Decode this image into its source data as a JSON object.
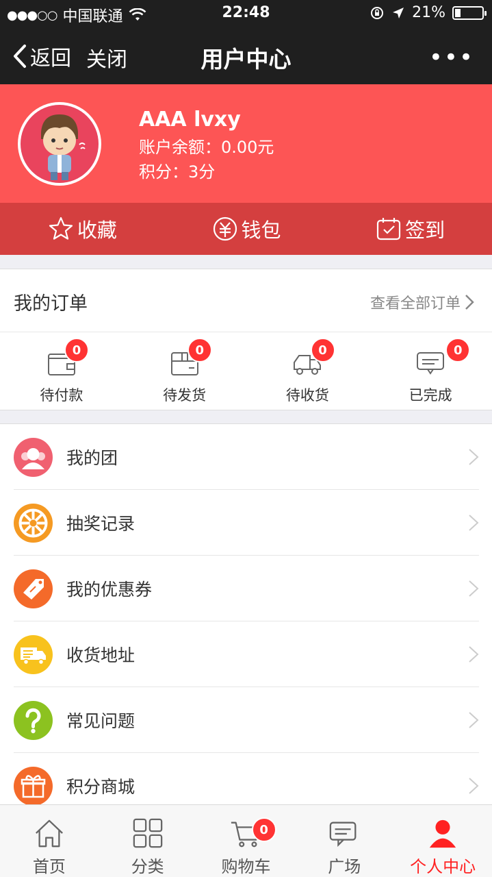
{
  "status_bar": {
    "signal": "●●●○○",
    "carrier": "中国联通",
    "time": "22:48",
    "battery": "21%"
  },
  "nav": {
    "back_label": "返回",
    "close_label": "关闭",
    "title": "用户中心",
    "more": "•••"
  },
  "profile": {
    "name": "AAA lvxy",
    "balance": "账户余额：0.00元",
    "points": "积分：3分"
  },
  "actions": [
    {
      "label": "收藏",
      "icon": "star-icon"
    },
    {
      "label": "钱包",
      "icon": "wallet-yuan-icon"
    },
    {
      "label": "签到",
      "icon": "checkin-calendar-icon"
    }
  ],
  "orders": {
    "title": "我的订单",
    "view_all": "查看全部订单",
    "items": [
      {
        "label": "待付款",
        "count": "0",
        "icon": "wallet-icon"
      },
      {
        "label": "待发货",
        "count": "0",
        "icon": "package-icon"
      },
      {
        "label": "待收货",
        "count": "0",
        "icon": "truck-icon"
      },
      {
        "label": "已完成",
        "count": "0",
        "icon": "chat-done-icon"
      }
    ]
  },
  "menu": [
    {
      "label": "我的团",
      "icon": "group-icon",
      "color": "#f06070"
    },
    {
      "label": "抽奖记录",
      "icon": "lottery-wheel-icon",
      "color": "#f59a23"
    },
    {
      "label": "我的优惠券",
      "icon": "coupon-tag-icon",
      "color": "#f46a2a"
    },
    {
      "label": "收货地址",
      "icon": "delivery-truck-icon",
      "color": "#f8c21d"
    },
    {
      "label": "常见问题",
      "icon": "question-icon",
      "color": "#8cc220"
    },
    {
      "label": "积分商城",
      "icon": "gift-icon",
      "color": "#f46a2a"
    }
  ],
  "tabbar": [
    {
      "label": "首页",
      "icon": "home-icon"
    },
    {
      "label": "分类",
      "icon": "grid-icon"
    },
    {
      "label": "购物车",
      "icon": "cart-icon",
      "badge": "0"
    },
    {
      "label": "广场",
      "icon": "chat-icon"
    },
    {
      "label": "个人中心",
      "icon": "person-icon",
      "active": true
    }
  ],
  "colors": {
    "header_bg": "#1f1f1f",
    "profile_bg": "#fd5555",
    "actions_bg": "#d43f3f",
    "badge": "#ff3333",
    "active_tab": "#ff2222"
  }
}
